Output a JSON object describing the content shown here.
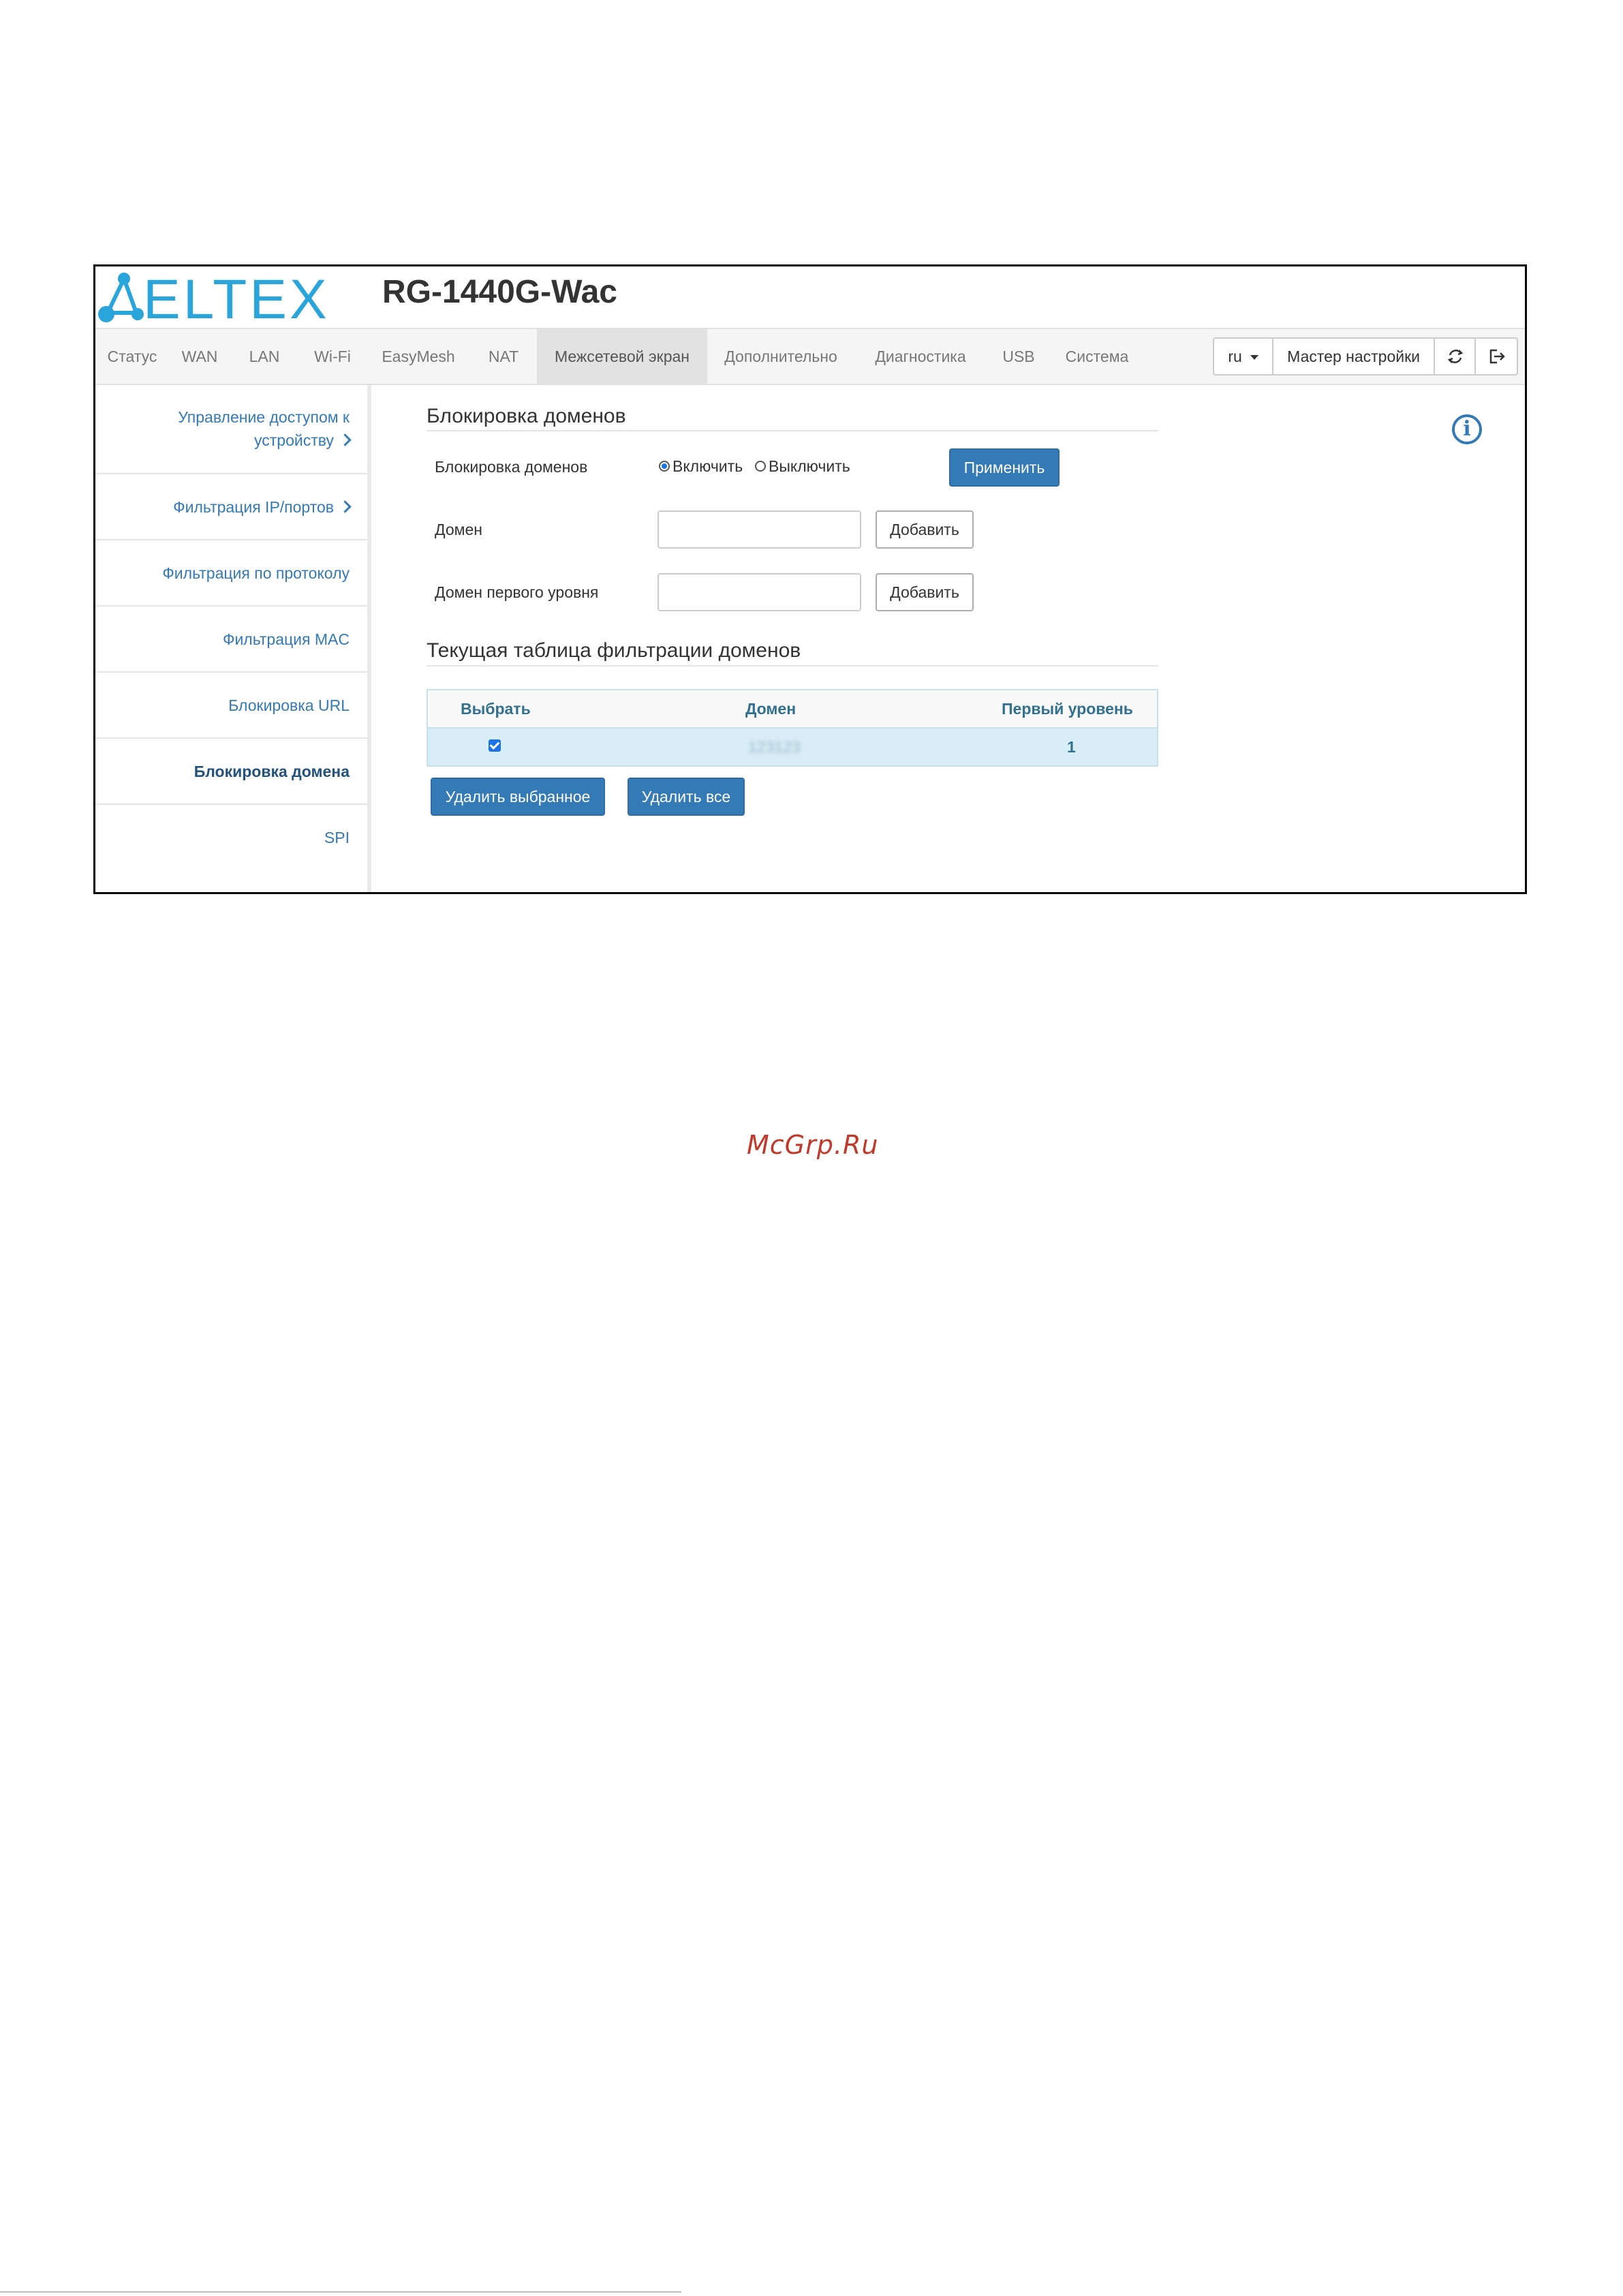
{
  "header": {
    "logo_text": "ELTEX",
    "model": "RG-1440G-Wac"
  },
  "nav": {
    "tabs": [
      {
        "label": "Статус"
      },
      {
        "label": "WAN"
      },
      {
        "label": "LAN"
      },
      {
        "label": "Wi-Fi"
      },
      {
        "label": "EasyMesh"
      },
      {
        "label": "NAT"
      },
      {
        "label": "Межсетевой экран",
        "active": true
      },
      {
        "label": "Дополнительно"
      },
      {
        "label": "Диагностика"
      },
      {
        "label": "USB"
      },
      {
        "label": "Система"
      }
    ],
    "language": "ru",
    "wizard": "Мастер настройки",
    "refresh_icon": "refresh-icon",
    "logout_icon": "logout-icon"
  },
  "sidebar": {
    "items": [
      {
        "label_line1": "Управление доступом к",
        "label_line2": "устройству"
      },
      {
        "label": "Фильтрация IP/портов"
      },
      {
        "label": "Фильтрация по протоколу"
      },
      {
        "label": "Фильтрация MAC"
      },
      {
        "label": "Блокировка URL"
      },
      {
        "label": "Блокировка домена",
        "active": true
      },
      {
        "label": "SPI"
      }
    ]
  },
  "main": {
    "section_title": "Блокировка доменов",
    "blocking": {
      "label": "Блокировка доменов",
      "enable_label": "Включить",
      "disable_label": "Выключить",
      "selected": "enable",
      "apply_label": "Применить"
    },
    "domain": {
      "label": "Домен",
      "value": "",
      "add_label": "Добавить"
    },
    "tld": {
      "label": "Домен первого уровня",
      "value": "",
      "add_label": "Добавить"
    },
    "table_title": "Текущая таблица фильтрации доменов",
    "table": {
      "headers": [
        "Выбрать",
        "Домен",
        "Первый уровень"
      ],
      "rows": [
        {
          "selected": true,
          "domain": "123123",
          "first_level": "1"
        }
      ]
    },
    "delete_selected_label": "Удалить выбранное",
    "delete_all_label": "Удалить все",
    "info_icon": "info-icon"
  },
  "watermark": "McGrp.Ru",
  "colors": {
    "accent": "#337ab7",
    "logo": "#29a5dc",
    "table_row": "#d9edf7"
  }
}
